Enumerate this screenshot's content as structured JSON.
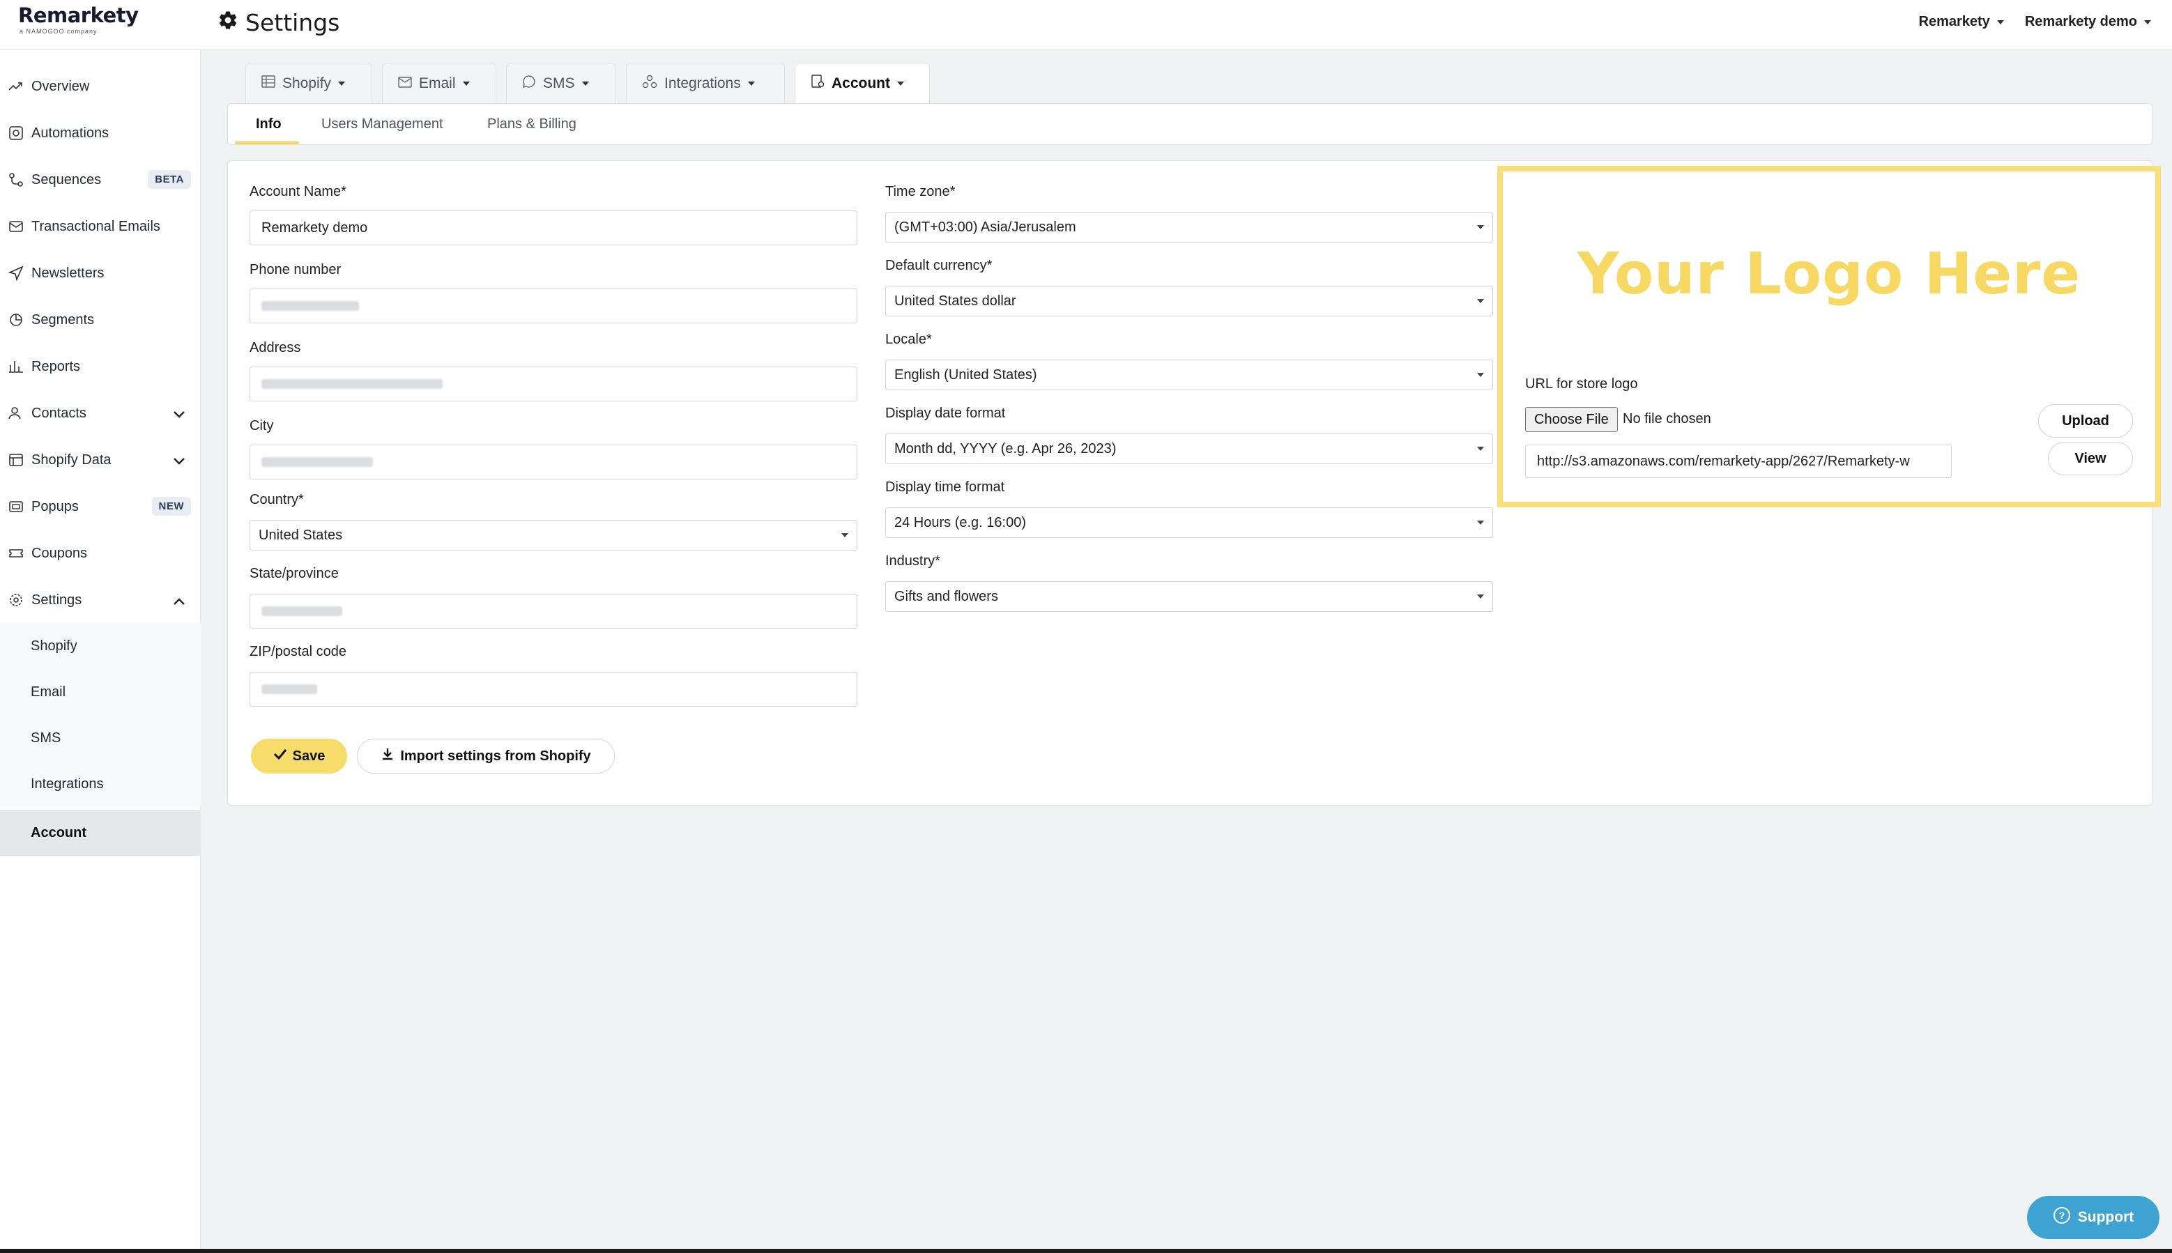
{
  "app": {
    "logo_text": "Remarkety",
    "logo_subtext": "a NAMOGOO company",
    "page_title": "Settings"
  },
  "topbar": {
    "account_menu": "Remarkety",
    "store_menu": "Remarkety demo"
  },
  "sidebar": {
    "items": [
      {
        "label": "Overview",
        "icon": "trend-icon"
      },
      {
        "label": "Automations",
        "icon": "automation-icon"
      },
      {
        "label": "Sequences",
        "icon": "sequence-icon",
        "badge": "BETA"
      },
      {
        "label": "Transactional Emails",
        "icon": "email-icon"
      },
      {
        "label": "Newsletters",
        "icon": "send-icon"
      },
      {
        "label": "Segments",
        "icon": "segments-icon"
      },
      {
        "label": "Reports",
        "icon": "reports-icon"
      },
      {
        "label": "Contacts",
        "icon": "contacts-icon"
      },
      {
        "label": "Shopify Data",
        "icon": "data-icon"
      },
      {
        "label": "Popups",
        "icon": "popup-icon",
        "badge": "NEW"
      },
      {
        "label": "Coupons",
        "icon": "coupon-icon"
      },
      {
        "label": "Settings",
        "icon": "gear-icon"
      }
    ],
    "settings_sub": [
      {
        "label": "Shopify"
      },
      {
        "label": "Email"
      },
      {
        "label": "SMS"
      },
      {
        "label": "Integrations"
      },
      {
        "label": "Account"
      }
    ]
  },
  "tabs": [
    {
      "label": "Shopify"
    },
    {
      "label": "Email"
    },
    {
      "label": "SMS"
    },
    {
      "label": "Integrations"
    },
    {
      "label": "Account"
    }
  ],
  "subtabs": [
    {
      "label": "Info"
    },
    {
      "label": "Users Management"
    },
    {
      "label": "Plans & Billing"
    }
  ],
  "form": {
    "account_name_label": "Account Name",
    "account_name_value": "Remarkety demo",
    "phone_label": "Phone number",
    "address_label": "Address",
    "city_label": "City",
    "country_label": "Country",
    "country_value": "United States",
    "state_label": "State/province",
    "zip_label": "ZIP/postal code",
    "timezone_label": "Time zone",
    "timezone_value": "(GMT+03:00) Asia/Jerusalem",
    "currency_label": "Default currency",
    "currency_value": "United States dollar",
    "locale_label": "Locale",
    "locale_value": "English (United States)",
    "date_format_label": "Display date format",
    "date_format_value": "Month dd, YYYY (e.g. Apr 26, 2023)",
    "time_format_label": "Display time format",
    "time_format_value": "24 Hours (e.g. 16:00)",
    "industry_label": "Industry",
    "industry_value": "Gifts and flowers",
    "required_mark": "*"
  },
  "logo_panel": {
    "placeholder_text": "Your Logo Here",
    "url_label": "URL for store logo",
    "choose_file_label": "Choose File",
    "no_file_text": "No file chosen",
    "upload_label": "Upload",
    "url_value": "http://s3.amazonaws.com/remarkety-app/2627/Remarkety-w",
    "view_label": "View",
    "highlight_color": "#f7e07b"
  },
  "actions": {
    "save_label": "Save",
    "import_label": "Import settings from Shopify"
  },
  "support": {
    "label": "Support"
  },
  "colors": {
    "accent": "#f6dd6b",
    "support_bg": "#3fa3d1"
  }
}
